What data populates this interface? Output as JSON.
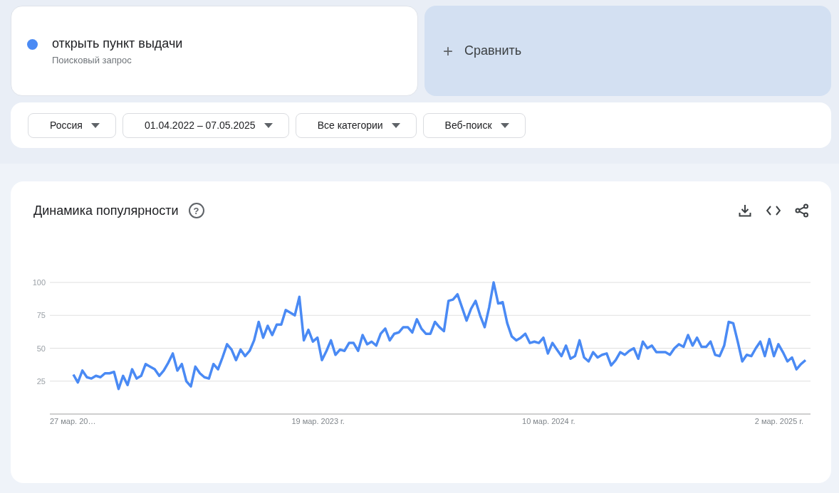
{
  "search_term": {
    "label": "открыть пункт выдачи",
    "sublabel": "Поисковый запрос",
    "color": "#4a8af4"
  },
  "compare": {
    "icon": "+",
    "label": "Сравнить"
  },
  "filters": [
    {
      "label": "Россия"
    },
    {
      "label": "01.04.2022 – 07.05.2025"
    },
    {
      "label": "Все категории"
    },
    {
      "label": "Веб-поиск"
    }
  ],
  "interest_card": {
    "title": "Динамика популярности",
    "help_icon": "?",
    "x_axis_labels": [
      "27 мар. 20…",
      "19 мар. 2023 г.",
      "10 мар. 2024 г.",
      "2 мар. 2025 г."
    ],
    "chart_data": {
      "type": "line",
      "grid": true,
      "ylim": [
        0,
        100
      ],
      "yticks": [
        25,
        50,
        75,
        100
      ],
      "series": [
        {
          "color": "#4a8af4",
          "values": [
            30,
            24,
            33,
            28,
            27,
            29,
            28,
            31,
            31,
            32,
            19,
            29,
            22,
            34,
            27,
            29,
            38,
            36,
            34,
            29,
            33,
            39,
            46,
            33,
            38,
            25,
            21,
            36,
            31,
            28,
            27,
            38,
            34,
            43,
            53,
            49,
            41,
            49,
            44,
            48,
            56,
            70,
            58,
            67,
            60,
            68,
            68,
            79,
            77,
            75,
            89,
            56,
            64,
            55,
            58,
            41,
            48,
            56,
            45,
            49,
            48,
            54,
            54,
            48,
            60,
            53,
            55,
            52,
            61,
            65,
            56,
            61,
            62,
            66,
            66,
            62,
            72,
            65,
            61,
            61,
            70,
            66,
            63,
            86,
            87,
            91,
            81,
            71,
            80,
            86,
            75,
            66,
            81,
            100,
            84,
            85,
            69,
            59,
            56,
            58,
            61,
            54,
            55,
            54,
            58,
            46,
            54,
            49,
            44,
            52,
            42,
            44,
            56,
            43,
            40,
            47,
            43,
            45,
            46,
            37,
            41,
            47,
            45,
            48,
            50,
            42,
            55,
            50,
            52,
            47,
            47,
            47,
            45,
            50,
            53,
            51,
            60,
            52,
            58,
            51,
            51,
            55,
            45,
            44,
            52,
            70,
            69,
            55,
            40,
            45,
            44,
            50,
            55,
            44,
            57,
            44,
            53,
            47,
            40,
            43,
            34,
            38,
            41
          ]
        }
      ]
    }
  }
}
